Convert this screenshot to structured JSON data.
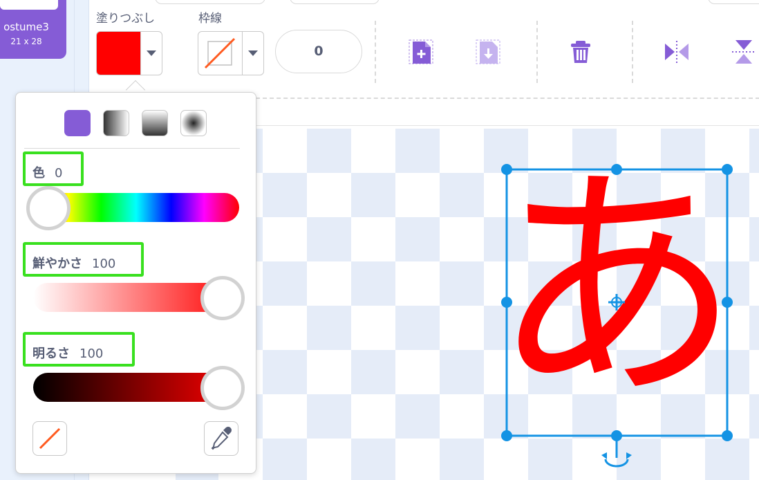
{
  "costume": {
    "name": "ostume3",
    "size": "21 x 28"
  },
  "toolbar": {
    "fill_label": "塗りつぶし",
    "outline_label": "枠線",
    "outline_width": "0",
    "fill_color": "#ff0000"
  },
  "icons": [
    "add-shape-icon",
    "export-icon",
    "delete-icon",
    "flip-horizontal-icon",
    "flip-vertical-icon",
    "no-color-icon",
    "eyedropper-icon",
    "rotate-handle-icon",
    "center-crosshair-icon"
  ],
  "color_picker": {
    "modes": [
      "solid",
      "horizontal-gradient",
      "vertical-gradient",
      "radial-gradient"
    ],
    "hue": {
      "label": "色",
      "value": "0"
    },
    "saturation": {
      "label": "鮮やかさ",
      "value": "100"
    },
    "brightness": {
      "label": "明るさ",
      "value": "100"
    }
  },
  "canvas": {
    "glyph": "あ",
    "glyph_color": "#ff0000",
    "selection_color": "#1493e4"
  }
}
